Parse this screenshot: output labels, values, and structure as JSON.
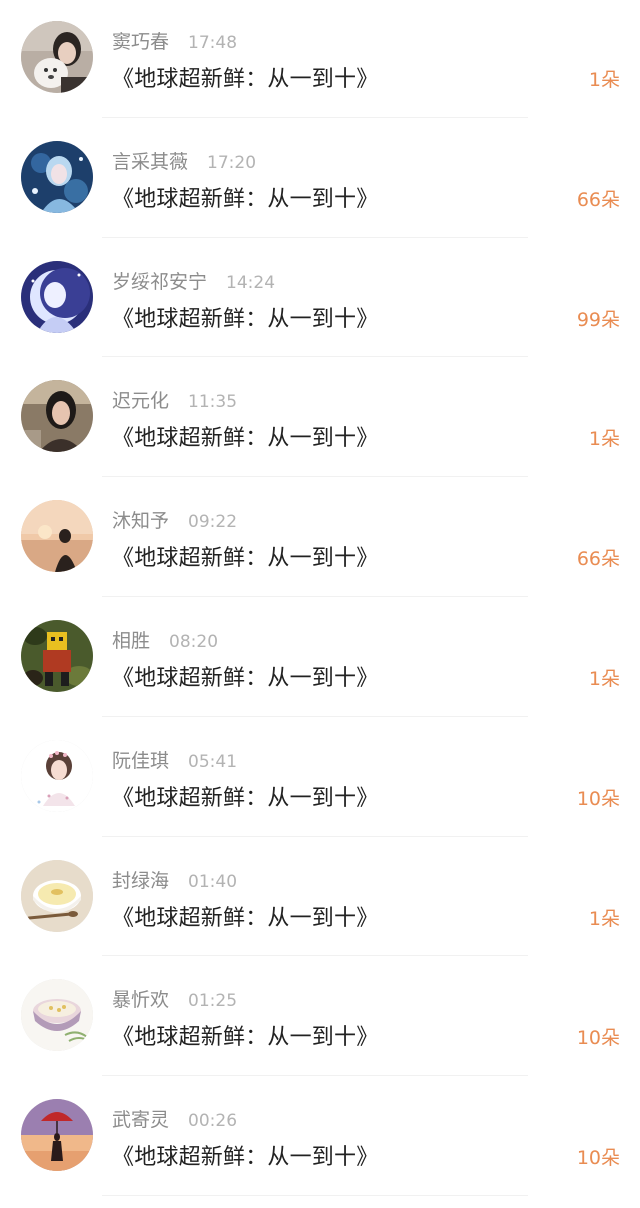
{
  "rows": [
    {
      "name": "窦巧春",
      "time": "17:48",
      "title": "《地球超新鲜：从一到十》",
      "count": "1朵",
      "avatar": "avatar-girl-with-dog"
    },
    {
      "name": "言采其薇",
      "time": "17:20",
      "title": "《地球超新鲜：从一到十》",
      "count": "66朵",
      "avatar": "avatar-fantasy-blue-girl"
    },
    {
      "name": "岁绥祁安宁",
      "time": "14:24",
      "title": "《地球超新鲜：从一到十》",
      "count": "99朵",
      "avatar": "avatar-moon-girl"
    },
    {
      "name": "迟元化",
      "time": "11:35",
      "title": "《地球超新鲜：从一到十》",
      "count": "1朵",
      "avatar": "avatar-woman-portrait"
    },
    {
      "name": "沐知予",
      "time": "09:22",
      "title": "《地球超新鲜：从一到十》",
      "count": "66朵",
      "avatar": "avatar-sunset-silhouette"
    },
    {
      "name": "相胜",
      "time": "08:20",
      "title": "《地球超新鲜：从一到十》",
      "count": "1朵",
      "avatar": "avatar-robot-camo"
    },
    {
      "name": "阮佳琪",
      "time": "05:41",
      "title": "《地球超新鲜：从一到十》",
      "count": "10朵",
      "avatar": "avatar-illustrated-girl"
    },
    {
      "name": "封绿海",
      "time": "01:40",
      "title": "《地球超新鲜：从一到十》",
      "count": "1朵",
      "avatar": "avatar-pudding-bowl"
    },
    {
      "name": "暴忻欢",
      "time": "01:25",
      "title": "《地球超新鲜：从一到十》",
      "count": "10朵",
      "avatar": "avatar-dessert-bowl"
    },
    {
      "name": "武寄灵",
      "time": "00:26",
      "title": "《地球超新鲜：从一到十》",
      "count": "10朵",
      "avatar": "avatar-umbrella-girl"
    }
  ],
  "colors": {
    "name": "#8c8c8c",
    "time": "#b3b3b3",
    "title": "#222222",
    "count": "#e98c52",
    "divider": "#f1f1f1"
  }
}
